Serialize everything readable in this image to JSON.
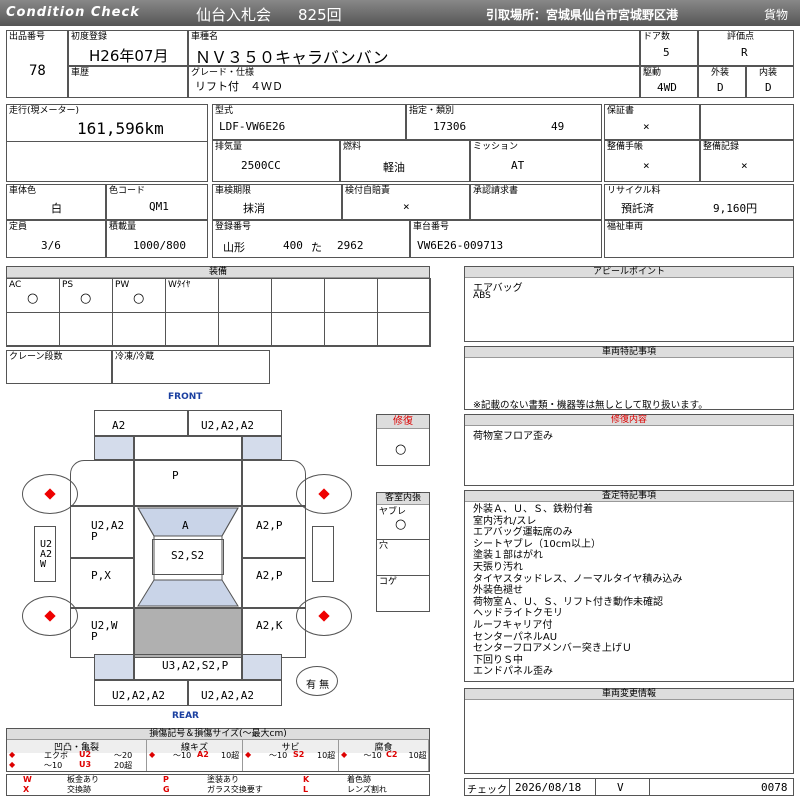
{
  "header": {
    "logo": "Condition Check",
    "auction": "仙台入札会",
    "session": "825回",
    "pickup": "引取場所：宮城県仙台市宮城野区港",
    "category": "貨物"
  },
  "vehicle": {
    "lot_label": "出品番号",
    "lot": "78",
    "first_reg_label": "初度登録",
    "first_reg": "H26年07月",
    "name_label": "車種名",
    "name": "ＮＶ３５０キャラバンバン",
    "doors_label": "ドア数",
    "doors": "5",
    "grade_eval_label": "評価点",
    "grade_eval": "R",
    "history_label": "車歴",
    "grade_label": "グレード・仕様",
    "grade": "リフト付　４ＷＤ",
    "drive_label": "駆動",
    "drive": "4WD",
    "exterior_label": "外装",
    "exterior": "D",
    "interior_label": "内装",
    "interior": "D",
    "mileage_label": "走行(現メーター)",
    "mileage": "161,596km",
    "model_label": "型式",
    "model": "LDF-VW6E26",
    "designation_label": "指定・類別",
    "designation": "17306",
    "class": "49",
    "warranty_label": "保証書",
    "warranty": "×",
    "displacement_label": "排気量",
    "displacement": "2500CC",
    "fuel_label": "燃料",
    "fuel": "軽油",
    "mission_label": "ミッション",
    "mission": "AT",
    "maint_book_label": "整備手帳",
    "maint_book": "×",
    "maint_record_label": "整備記録",
    "maint_record": "×",
    "body_color_label": "車体色",
    "body_color": "白",
    "color_code_label": "色コード",
    "color_code": "QM1",
    "inspection_label": "車検期限",
    "inspection": "抹消",
    "insurance_label": "検付自賠責",
    "insurance": "×",
    "approval_label": "承認請求書",
    "recycle_label": "リサイクル料",
    "recycle_status": "預託済",
    "recycle_fee": "9,160円",
    "capacity_label": "定員",
    "capacity": "3/6",
    "load_label": "積載量",
    "load": "1000/800",
    "reg_no_label": "登録番号",
    "reg_area": "山形",
    "reg_class": "400",
    "reg_kana": "た",
    "reg_num": "2962",
    "chassis_label": "車台番号",
    "chassis": "VW6E26-009713",
    "welfare_label": "福祉車両"
  },
  "equipment": {
    "title": "装備",
    "items": [
      {
        "label": "AC",
        "mark": "○"
      },
      {
        "label": "PS",
        "mark": "○"
      },
      {
        "label": "PW",
        "mark": "○"
      },
      {
        "label": "Wﾀｲﾔ",
        "mark": ""
      }
    ],
    "crane_label": "クレーン段数",
    "freezer_label": "冷凍/冷蔵"
  },
  "appeal": {
    "title": "アピールポイント",
    "lines": [
      "エアバッグ",
      "ABS"
    ]
  },
  "special": {
    "title": "車両特記事項",
    "note": "※記載のない書類・機器等は無しとして取り扱います。"
  },
  "repair": {
    "title": "修復",
    "mark": "○",
    "content_title": "修復内容",
    "lines": [
      "荷物室フロア歪み"
    ]
  },
  "cabin": {
    "title": "客室内張",
    "items": [
      {
        "label": "ヤブレ",
        "mark": "○"
      },
      {
        "label": "穴",
        "mark": ""
      },
      {
        "label": "コゲ",
        "mark": ""
      }
    ]
  },
  "inspection_notes": {
    "title": "査定特記事項",
    "lines": [
      "外装Ａ、Ｕ、Ｓ、鉄粉付着",
      "室内汚れ/スレ",
      "エアバッグ運転席のみ",
      "シートヤブレ（10cm以上）",
      "塗装１部はがれ",
      "天張り汚れ",
      "タイヤスタッドレス、ノーマルタイヤ積み込み",
      "外装色褪せ",
      "荷物室Ａ、Ｕ、Ｓ、リフト付き動作未確認",
      "ヘッドライトクモリ",
      "ルーフキャリア付",
      "センターパネルAU",
      "センターフロアメンバー突き上げＵ",
      "下回りＳ中",
      "エンドパネル歪み"
    ]
  },
  "change_info": {
    "title": "車両変更情報"
  },
  "diagram": {
    "front": "FRONT",
    "rear": "REAR",
    "cells": {
      "front_left": "A2",
      "front_right": "U2,A2,A2",
      "hood": "P",
      "windshield": "A",
      "roof": "S2,S2",
      "left_front_door": "U2,A2\nP",
      "right_front_door": "A2,P",
      "left_mid": "P,X",
      "right_mid": "A2,P",
      "left_rear": "U2,W\nP",
      "right_rear": "A2,K",
      "rear_center": "U3,A2,S2,P",
      "rear_left": "U2,A2,A2",
      "rear_right": "U2,A2,A2",
      "mirror_left": "U2\nA2\nW"
    },
    "spare_label": "有 無"
  },
  "legend": {
    "title": "損傷記号＆損傷サイズ(～最大cm)",
    "groups": [
      {
        "name": "凹凸・亀裂",
        "items": [
          [
            "◆",
            "エクボ",
            "U2",
            "～20"
          ],
          [
            "◆",
            "～10",
            "U3",
            "20超"
          ]
        ]
      },
      {
        "name": "線キズ",
        "items": [
          [
            "◆",
            "～10",
            "A2",
            "10超"
          ]
        ]
      },
      {
        "name": "サビ",
        "items": [
          [
            "◆",
            "～10",
            "S2",
            "10超"
          ]
        ]
      },
      {
        "name": "腐食",
        "items": [
          [
            "◆",
            "～10",
            "C2",
            "10超"
          ]
        ]
      }
    ],
    "codes": [
      [
        "W",
        "板金あり",
        "P",
        "塗装あり",
        "K",
        "着色跡"
      ],
      [
        "X",
        "交換跡",
        "G",
        "ガラス交換要す",
        "L",
        "レンズ割れ"
      ]
    ]
  },
  "footer": {
    "check_label": "チェック",
    "date": "2026/08/18",
    "inspector": "V",
    "code": "0078"
  }
}
